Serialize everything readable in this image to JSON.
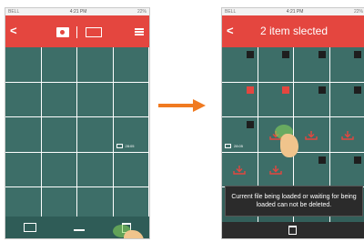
{
  "status_bar": {
    "carrier": "BELL",
    "time": "4:21 PM",
    "battery": "22%"
  },
  "left_screen": {
    "header": {
      "back_label": "<"
    },
    "video_duration": "28:05",
    "toolbar": {
      "icons": [
        "swap-media-icon",
        "download-icon",
        "trash-icon"
      ]
    }
  },
  "right_screen": {
    "header": {
      "back_label": "<",
      "title": "2 item slected"
    },
    "video_duration": "28:05",
    "toast": "Current  file  being loaded or waiting for being loaded can not be deleted."
  },
  "colors": {
    "accent": "#e4463f",
    "tile": "#3d6e68",
    "checked": "#e4463f"
  }
}
